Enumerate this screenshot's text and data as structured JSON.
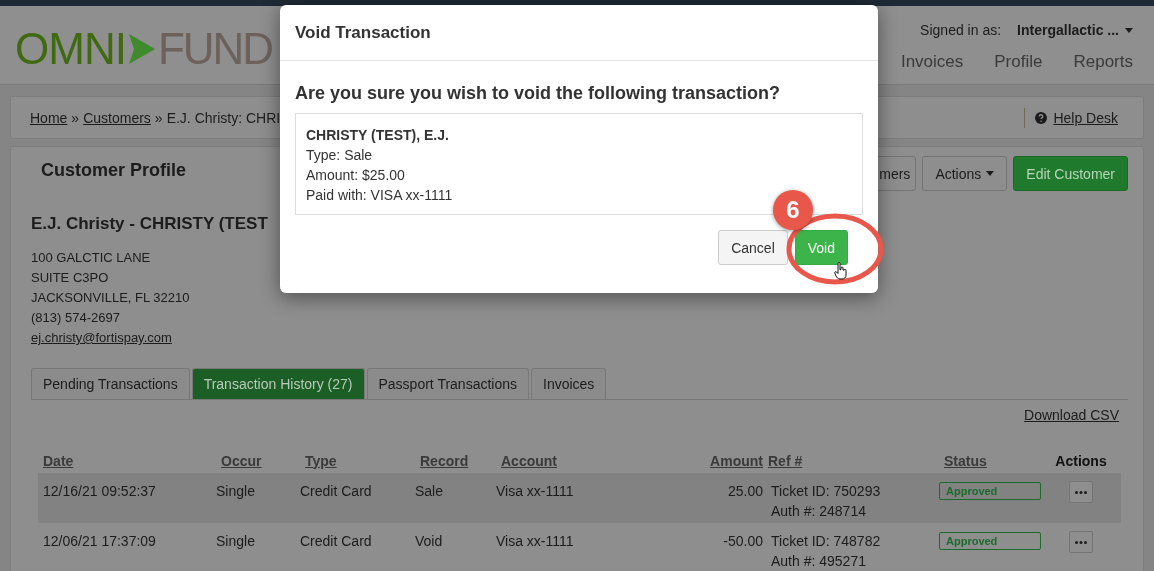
{
  "header": {
    "logo": {
      "left": "OMNI",
      "right": "FUND"
    },
    "signed_in_label": "Signed in as:",
    "account_menu": "Intergallactic ...",
    "nav": [
      "Invoices",
      "Profile",
      "Reports"
    ]
  },
  "breadcrumb": {
    "items": [
      {
        "text": "Home",
        "kind": "link"
      },
      {
        "text": "»",
        "kind": "separator"
      },
      {
        "text": "Customers",
        "kind": "link"
      },
      {
        "text": "»",
        "kind": "separator"
      },
      {
        "text": "E.J. Christy: CHRI",
        "kind": "current"
      }
    ],
    "help": "Help Desk"
  },
  "profile": {
    "title": "Customer Profile",
    "buttons": [
      {
        "label": "mers",
        "kind": "default"
      },
      {
        "label": "Actions",
        "kind": "dropdown"
      },
      {
        "label": "Edit Customer",
        "kind": "primary"
      }
    ],
    "name": "E.J. Christy - CHRISTY (TEST",
    "address": [
      "100 GALCTIC LANE",
      "SUITE C3PO",
      "JACKSONVILLE, FL 32210",
      "(813) 574-2697"
    ],
    "email": "ej.christy@fortispay.com"
  },
  "tabs": [
    {
      "label": "Pending Transactions",
      "selected": false
    },
    {
      "label": "Transaction History (27)",
      "selected": true
    },
    {
      "label": "Passport Transactions",
      "selected": false
    },
    {
      "label": "Invoices",
      "selected": false
    }
  ],
  "download": "Download CSV",
  "table": {
    "columns": [
      {
        "label": "Date",
        "sortable": true
      },
      {
        "label": "Occur",
        "sortable": true
      },
      {
        "label": "Type",
        "sortable": true
      },
      {
        "label": "Record",
        "sortable": true
      },
      {
        "label": "Account",
        "sortable": true
      },
      {
        "label": "Amount",
        "sortable": true
      },
      {
        "label": "Ref #",
        "sortable": true
      },
      {
        "label": "Status",
        "sortable": true
      },
      {
        "label": "Actions",
        "sortable": false
      }
    ],
    "rows": [
      {
        "date": "12/16/21 09:52:37",
        "occur": "Single",
        "type": "Credit Card",
        "record": "Sale",
        "account": "Visa xx-1111",
        "amount": "25.00",
        "ref": [
          "Ticket ID: 750293",
          "Auth #: 248714"
        ],
        "status": "Approved"
      },
      {
        "date": "12/06/21 17:37:09",
        "occur": "Single",
        "type": "Credit Card",
        "record": "Void",
        "account": "Visa xx-1111",
        "amount": "-50.00",
        "ref": [
          "Ticket ID: 748782",
          "Auth #: 495271"
        ],
        "status": "Approved"
      }
    ]
  },
  "modal": {
    "title": "Void Transaction",
    "question": "Are you sure you wish to void the following transaction?",
    "details": {
      "name": "CHRISTY (TEST), E.J.",
      "lines": [
        "Type: Sale",
        "Amount: $25.00",
        "Paid with: VISA xx-1111"
      ]
    },
    "buttons": [
      {
        "label": "Cancel",
        "kind": "default"
      },
      {
        "label": "Void",
        "kind": "success"
      }
    ],
    "annotation": {
      "step": "6"
    }
  }
}
